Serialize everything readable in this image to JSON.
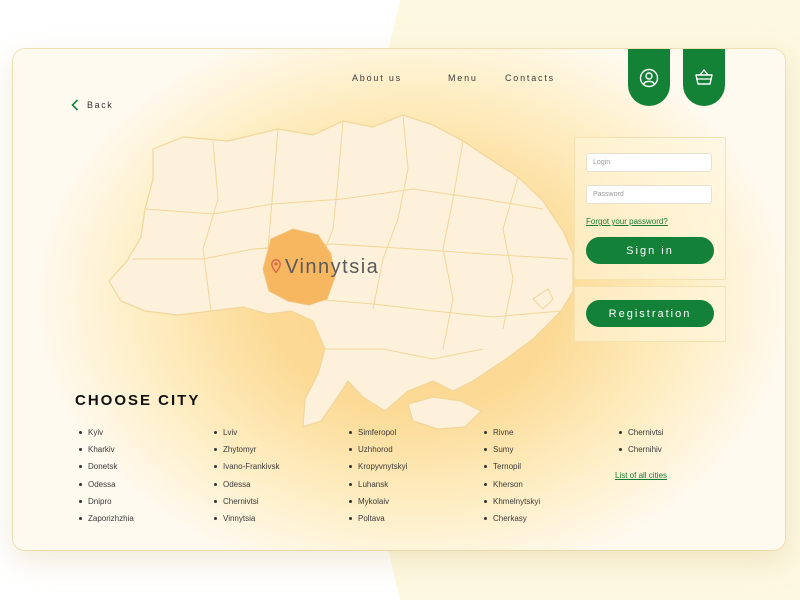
{
  "nav": {
    "about_label": "About us",
    "menu_label": "Menu",
    "contacts_label": "Contacts",
    "user_icon": "user-icon",
    "basket_icon": "basket-icon"
  },
  "back": {
    "label": "Back",
    "icon": "chevron-left-icon"
  },
  "map": {
    "selected_city": "Vinnytsia",
    "pin_icon": "map-pin-icon"
  },
  "login": {
    "login_placeholder": "Login",
    "password_placeholder": "Password",
    "forgot_label": "Forgot your password?",
    "signin_label": "Sign in",
    "registration_label": "Registration"
  },
  "cities": {
    "title": "CHOOSE CITY",
    "columns": [
      [
        "Kyiv",
        "Kharkiv",
        "Donetsk",
        "Odessa",
        "Dnipro",
        "Zaporizhzhia"
      ],
      [
        "Lviv",
        "Zhytomyr",
        "Ivano-Frankivsk",
        "Odessa",
        "Chernivtsi",
        "Vinnytsia"
      ],
      [
        "Simferopol",
        "Uzhhorod",
        "Kropyvnytskyi",
        "Luhansk",
        "Mykolaiv",
        "Poltava"
      ],
      [
        "Rivne",
        "Sumy",
        "Ternopil",
        "Kherson",
        "Khmelnytskyi",
        "Cherkasy"
      ],
      [
        "Chernivtsi",
        "Chernihiv"
      ]
    ],
    "all_cities_label": "List of all cities"
  },
  "colors": {
    "accent_green": "#148139",
    "highlight_region": "#f6b760",
    "map_fill": "#fdf1dc",
    "background_shape": "#fdf8e0"
  }
}
